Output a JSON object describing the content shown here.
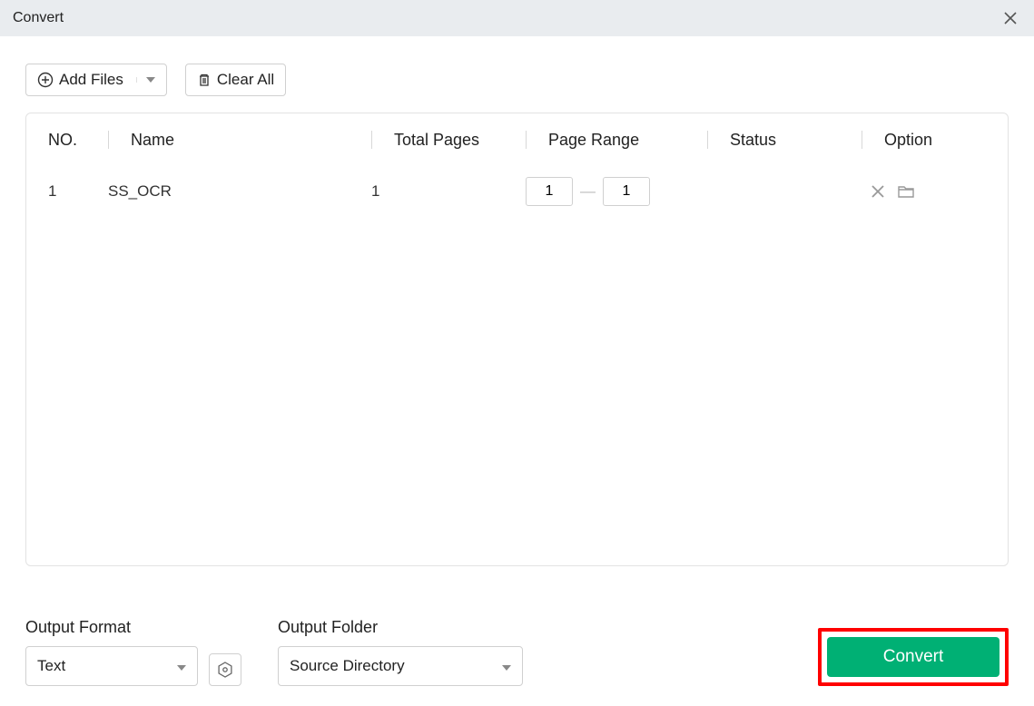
{
  "titlebar": {
    "title": "Convert"
  },
  "toolbar": {
    "add_files_label": "Add Files",
    "clear_all_label": "Clear All"
  },
  "table": {
    "headers": {
      "no": "NO.",
      "name": "Name",
      "total_pages": "Total Pages",
      "page_range": "Page Range",
      "status": "Status",
      "option": "Option"
    },
    "rows": [
      {
        "no": "1",
        "name": "SS_OCR",
        "total_pages": "1",
        "range_from": "1",
        "range_to": "1",
        "status": ""
      }
    ]
  },
  "footer": {
    "output_format_label": "Output Format",
    "output_format_value": "Text",
    "output_folder_label": "Output Folder",
    "output_folder_value": "Source Directory",
    "convert_label": "Convert"
  }
}
